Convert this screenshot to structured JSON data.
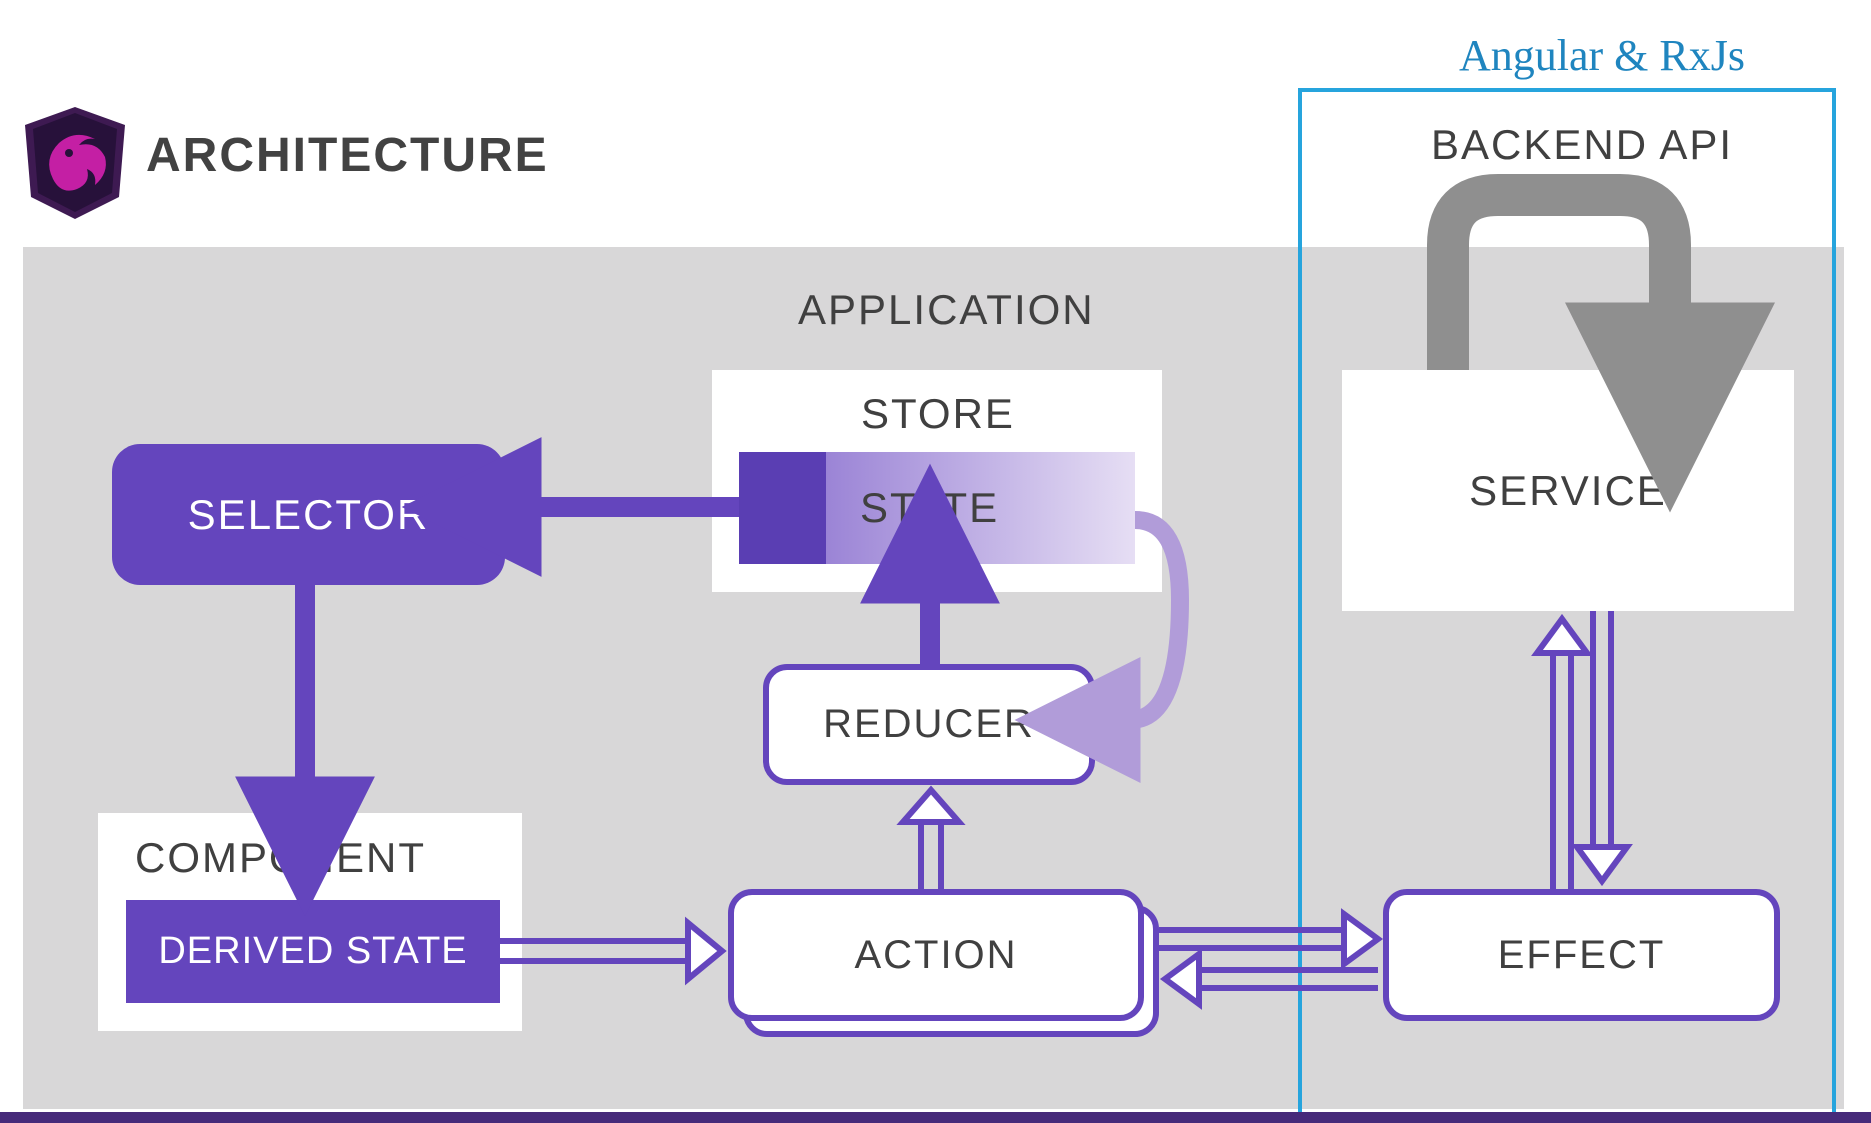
{
  "header": {
    "title": "ARCHITECTURE",
    "logo_icon": "ngrx-logo"
  },
  "annotation": {
    "label": "Angular & RxJs",
    "color": "#26a4dd"
  },
  "diagram": {
    "application_label": "APPLICATION",
    "store": {
      "label": "STORE",
      "state_label": "STATE"
    },
    "selector_label": "SELECTOR",
    "component": {
      "label": "COMPONENT",
      "derived_state_label": "DERIVED STATE"
    },
    "reducer_label": "REDUCER",
    "action_label": "ACTION",
    "effect_label": "EFFECT",
    "service_label": "SERVICE",
    "backend_label": "BACKEND API"
  },
  "connections": [
    {
      "from": "state",
      "to": "selector",
      "style": "solid-filled",
      "color": "#6445bd"
    },
    {
      "from": "selector",
      "to": "derived-state",
      "style": "solid-filled",
      "color": "#6445bd"
    },
    {
      "from": "reducer",
      "to": "state",
      "style": "solid-filled",
      "color": "#6445bd"
    },
    {
      "from": "state",
      "to": "reducer",
      "style": "curve",
      "color": "#b19cd9"
    },
    {
      "from": "action",
      "to": "reducer",
      "style": "hollow",
      "color": "#6445bd"
    },
    {
      "from": "derived-state",
      "to": "action",
      "style": "hollow",
      "color": "#6445bd"
    },
    {
      "from": "action",
      "to": "effect",
      "style": "hollow-bidir",
      "color": "#6445bd"
    },
    {
      "from": "effect",
      "to": "service",
      "style": "hollow-bidir",
      "color": "#6445bd"
    },
    {
      "from": "service",
      "to": "backend",
      "style": "thick-curve",
      "color": "#8f8f8f"
    }
  ],
  "colors": {
    "purple": "#6445bd",
    "purple_light": "#b19cd9",
    "grey_panel": "#d8d7d8",
    "grey_arrow": "#8f8f8f",
    "annotation": "#26a4dd"
  }
}
